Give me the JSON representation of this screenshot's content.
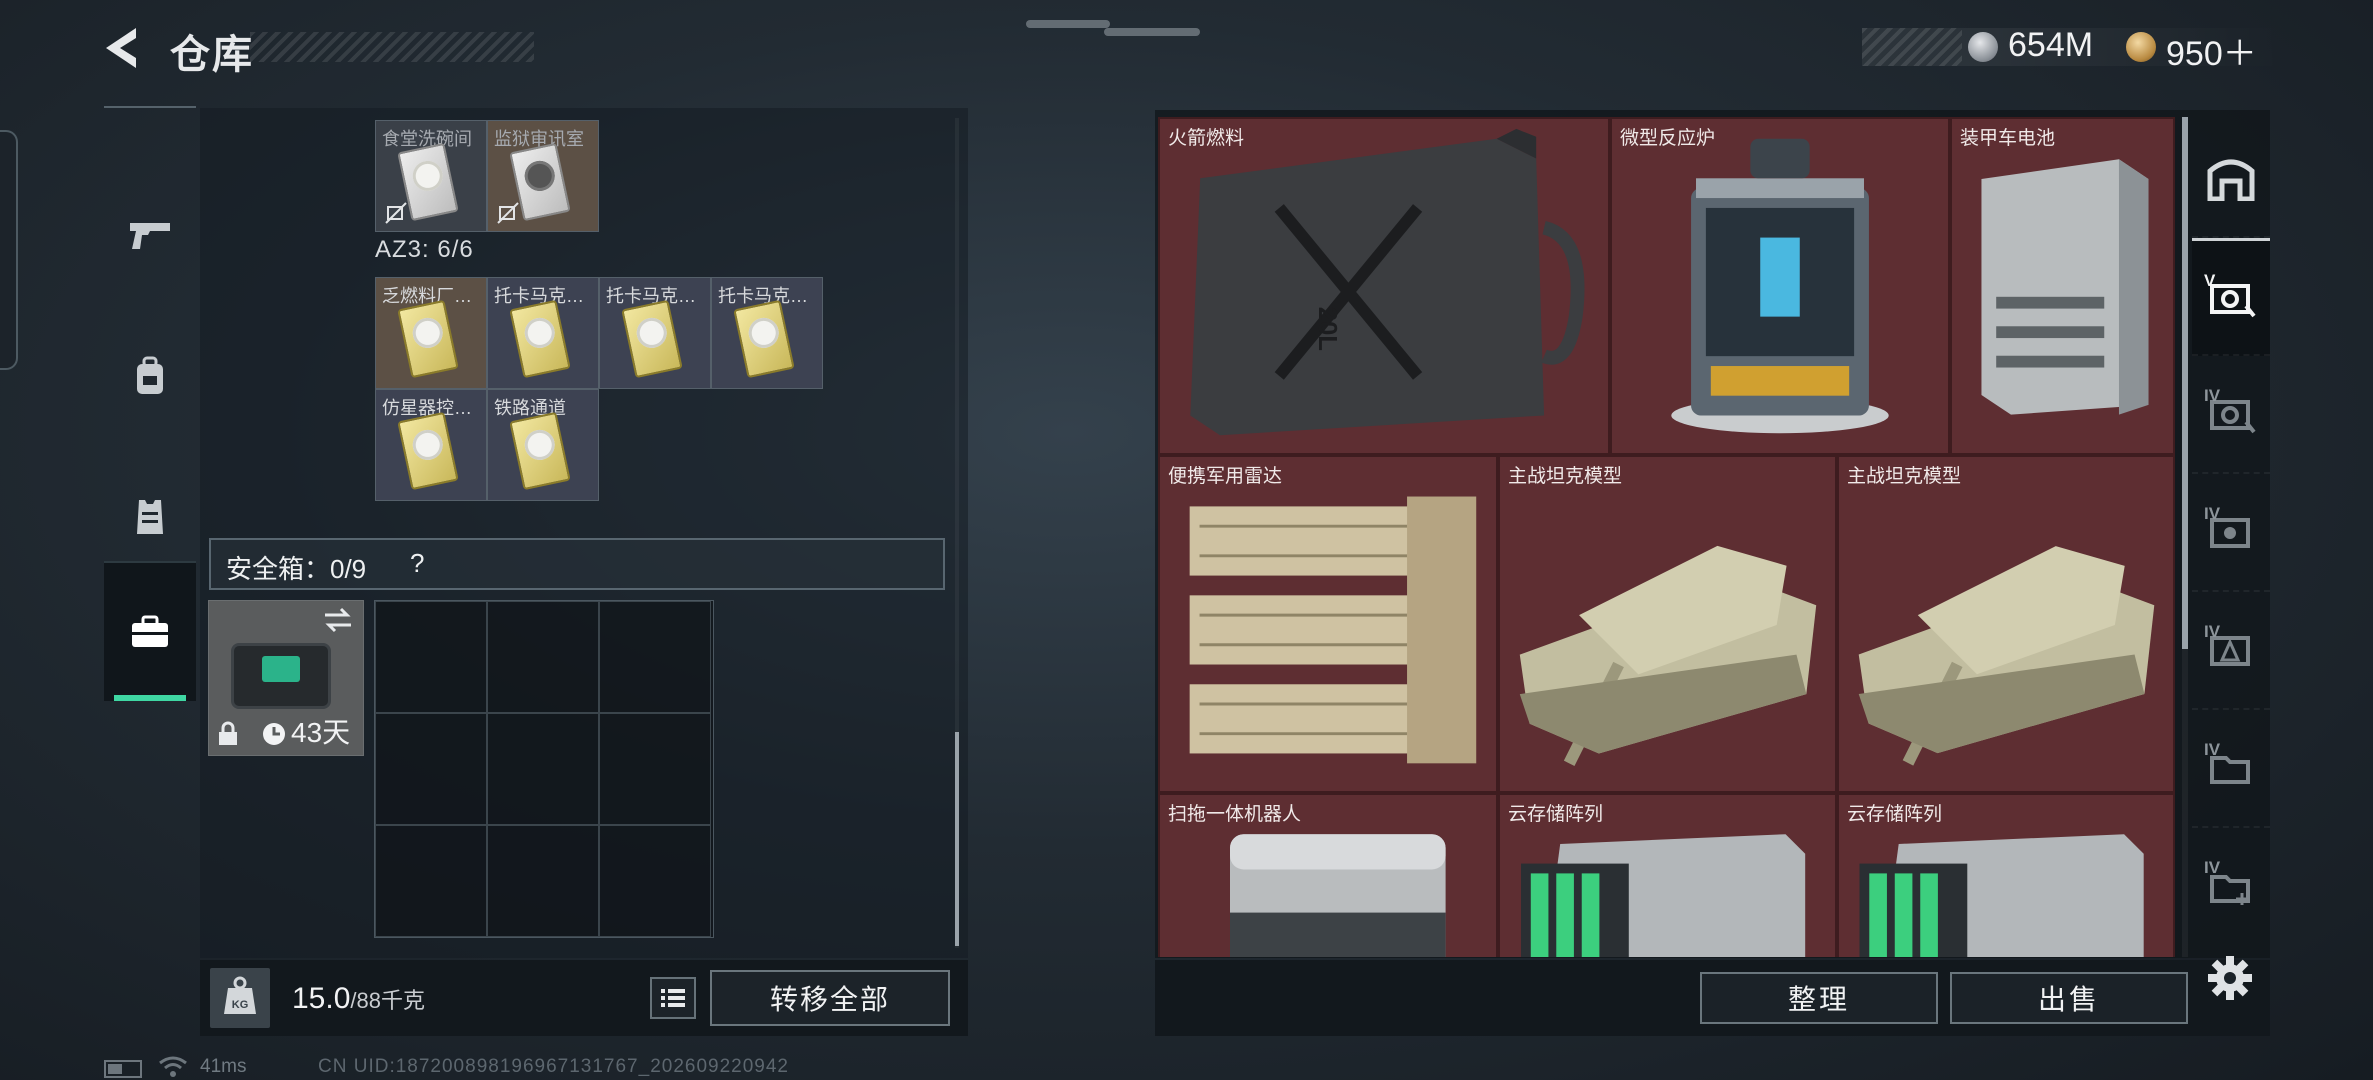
{
  "header": {
    "title": "仓库",
    "currency_silver": "654M",
    "currency_gold": "950＋"
  },
  "colors": {
    "accent_green": "#3fd7a3",
    "stash_bg": "#5a2c30",
    "panel_dark": "#12181d"
  },
  "side_tabs": [
    {
      "icon": "pistol-icon"
    },
    {
      "icon": "backpack-icon"
    },
    {
      "icon": "vest-icon"
    },
    {
      "icon": "briefcase-icon",
      "active": true
    }
  ],
  "left_panel": {
    "top_row": [
      {
        "label": "食堂洗碗间",
        "bg": "gray",
        "card": "white"
      },
      {
        "label": "监狱审讯室",
        "bg": "brown",
        "card": "dark"
      }
    ],
    "az3_label": "AZ3: 6/6",
    "az3_row1": [
      {
        "label": "乏燃料厂…",
        "bg": "brown",
        "card": "yellow"
      },
      {
        "label": "托卡马克…",
        "bg": "blue",
        "card": "yellow"
      },
      {
        "label": "托卡马克…",
        "bg": "blue",
        "card": "yellow"
      },
      {
        "label": "托卡马克…",
        "bg": "blue",
        "card": "yellow"
      }
    ],
    "az3_row2": [
      {
        "label": "仿星器控…",
        "bg": "blue",
        "card": "yellow"
      },
      {
        "label": "铁路通道",
        "bg": "blue",
        "card": "yellow"
      }
    ],
    "safe_box_label": "安全箱：0/9",
    "help_mark": "?",
    "safe_case_days": "43天",
    "weight_value": "15.0",
    "weight_unit": "/88千克",
    "transfer_all": "转移全部"
  },
  "stash": {
    "items": [
      {
        "label": "火箭燃料",
        "art": "fuel-can"
      },
      {
        "label": "微型反应炉",
        "art": "reactor"
      },
      {
        "label": "装甲车电池",
        "art": "battery"
      },
      {
        "label": "便携军用雷达",
        "art": "radar"
      },
      {
        "label": "主战坦克模型",
        "art": "tank"
      },
      {
        "label": "主战坦克模型",
        "art": "tank"
      },
      {
        "label": "扫拖一体机器人",
        "art": "robot"
      },
      {
        "label": "云存储阵列",
        "art": "server"
      },
      {
        "label": "云存储阵列",
        "art": "server"
      }
    ],
    "fuel_can_text": "20L"
  },
  "right_tabs": [
    {
      "num": "",
      "icon": "building-icon"
    },
    {
      "num": "V",
      "icon": "category-v-icon",
      "active": true
    },
    {
      "num": "IV",
      "icon": "category-iv-a-icon"
    },
    {
      "num": "IV",
      "icon": "category-iv-b-icon"
    },
    {
      "num": "IV",
      "icon": "category-iv-c-icon"
    },
    {
      "num": "IV",
      "icon": "category-iv-d-icon"
    },
    {
      "num": "IV",
      "icon": "category-iv-e-icon"
    }
  ],
  "actions": {
    "organize": "整理",
    "sell": "出售"
  },
  "status": {
    "ping": "41ms",
    "uid": "CN UID:187200898196967131767_202609220942"
  }
}
